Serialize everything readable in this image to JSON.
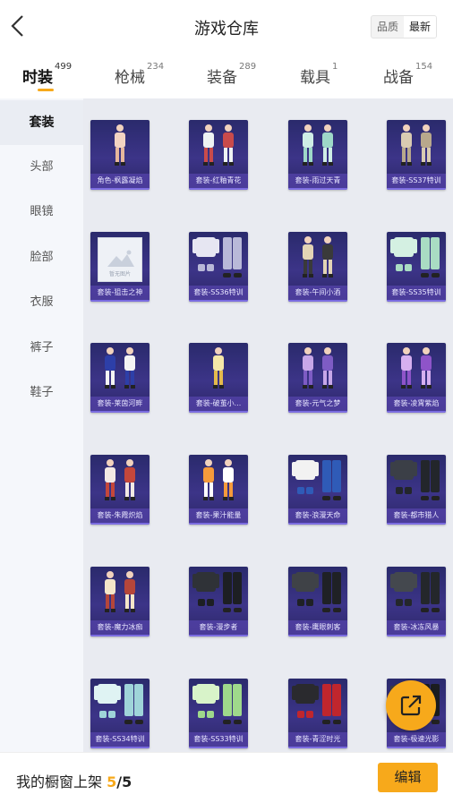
{
  "header": {
    "title": "游戏仓库",
    "sort": [
      "品质",
      "最新"
    ],
    "sort_active": 1
  },
  "tabs": [
    {
      "label": "时装",
      "count": "499",
      "active": true
    },
    {
      "label": "枪械",
      "count": "234",
      "active": false
    },
    {
      "label": "装备",
      "count": "289",
      "active": false
    },
    {
      "label": "载具",
      "count": "1",
      "active": false
    },
    {
      "label": "战备",
      "count": "154",
      "active": false
    }
  ],
  "sidebar": {
    "items": [
      {
        "label": "套装",
        "active": true
      },
      {
        "label": "头部",
        "active": false
      },
      {
        "label": "眼镜",
        "active": false
      },
      {
        "label": "脸部",
        "active": false
      },
      {
        "label": "衣服",
        "active": false
      },
      {
        "label": "裤子",
        "active": false
      },
      {
        "label": "鞋子",
        "active": false
      }
    ]
  },
  "items": [
    {
      "name": "角色-枫露凝焰",
      "figure": "single",
      "c1": "#f3d4c2",
      "c2": "#e7b79c"
    },
    {
      "name": "套装-红釉青花",
      "figure": "pair",
      "c1": "#eef3f3",
      "c2": "#c94b4b"
    },
    {
      "name": "套装-雨过天青",
      "figure": "pair",
      "c1": "#cfeee6",
      "c2": "#9ed8c8"
    },
    {
      "name": "套装-SS37特训",
      "figure": "pair",
      "c1": "#d9cbb2",
      "c2": "#b8a88c"
    },
    {
      "name": "套装-狙击之神",
      "figure": "placeholder",
      "c1": "#eef1f6",
      "c2": "#d4d9e2"
    },
    {
      "name": "套装-SS36特训",
      "figure": "set",
      "c1": "#e6e6f2",
      "c2": "#b9b9d8"
    },
    {
      "name": "套装-午间小酒",
      "figure": "pair",
      "c1": "#e3d4b5",
      "c2": "#3a3a3a"
    },
    {
      "name": "套装-SS35特训",
      "figure": "set",
      "c1": "#d4f0e2",
      "c2": "#a9dcc3"
    },
    {
      "name": "套装-莱茵河畔",
      "figure": "pair",
      "c1": "#2d3fa8",
      "c2": "#f4f4f4"
    },
    {
      "name": "套装-破茧小...",
      "figure": "single",
      "c1": "#f6e8a8",
      "c2": "#e4b94c"
    },
    {
      "name": "套装-元气之梦",
      "figure": "pair",
      "c1": "#c7a7e8",
      "c2": "#7e5cc4"
    },
    {
      "name": "套装-凌霄紫焰",
      "figure": "pair",
      "c1": "#d6b0f0",
      "c2": "#8e54c9"
    },
    {
      "name": "套装-朱霞炽焰",
      "figure": "pair",
      "c1": "#f2e9e4",
      "c2": "#c4473b"
    },
    {
      "name": "套装-果汁能量",
      "figure": "pair",
      "c1": "#f59a3b",
      "c2": "#ffffff"
    },
    {
      "name": "套装-浪漫天命",
      "figure": "set",
      "c1": "#f2f2f2",
      "c2": "#2f5bb7"
    },
    {
      "name": "套装-都市猎人",
      "figure": "set",
      "c1": "#3b3f47",
      "c2": "#23262b"
    },
    {
      "name": "套装-魔力冰痂",
      "figure": "pair",
      "c1": "#f4e6c9",
      "c2": "#b5463a"
    },
    {
      "name": "套装-漫步者",
      "figure": "set",
      "c1": "#2f3237",
      "c2": "#1d1f23"
    },
    {
      "name": "套装-鹰眼刺客",
      "figure": "set",
      "c1": "#3f4247",
      "c2": "#1f2125"
    },
    {
      "name": "套装-冰冻风暴",
      "figure": "set",
      "c1": "#44484e",
      "c2": "#24272b"
    },
    {
      "name": "套装-SS34特训",
      "figure": "set",
      "c1": "#dff3f3",
      "c2": "#9fd4d9"
    },
    {
      "name": "套装-SS33特训",
      "figure": "set",
      "c1": "#d8f3c9",
      "c2": "#9fd98b"
    },
    {
      "name": "套装-青涩时光",
      "figure": "set",
      "c1": "#2a2a2e",
      "c2": "#c0262d"
    },
    {
      "name": "套装-极速光影",
      "figure": "set",
      "c1": "#3a3d42",
      "c2": "#1b1d20"
    }
  ],
  "placeholder_text": "暂无图片",
  "footer": {
    "label": "我的橱窗上架",
    "current": "5",
    "separator": "/",
    "total": "5",
    "edit": "编辑"
  },
  "colors": {
    "accent": "#f7a91b",
    "card_bg": "#2a2a6c"
  }
}
